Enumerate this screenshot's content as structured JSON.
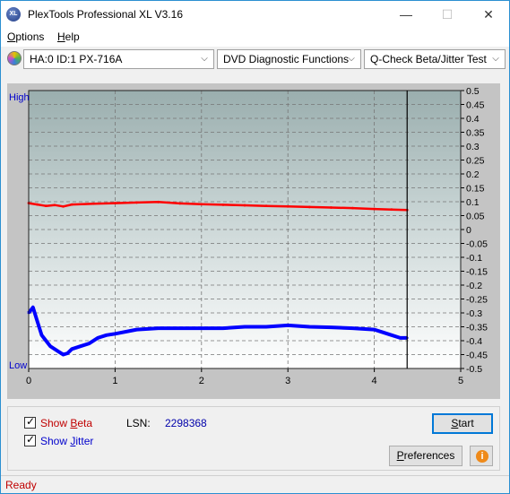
{
  "window": {
    "icon_text": "XL",
    "title": "PlexTools Professional XL V3.16",
    "minimize_glyph": "—",
    "maximize_glyph": "☐",
    "close_glyph": "✕"
  },
  "menu": {
    "items": [
      {
        "mnemonic": "O",
        "rest": "ptions"
      },
      {
        "mnemonic": "H",
        "rest": "elp"
      }
    ]
  },
  "toolbar": {
    "drive": "HA:0 ID:1  PX-716A",
    "function": "DVD Diagnostic Functions",
    "test": "Q-Check Beta/Jitter Test",
    "dropdown_glyph": "⌵"
  },
  "chart_data": {
    "type": "line",
    "left_axis": {
      "high_label": "High",
      "low_label": "Low"
    },
    "x_ticks": [
      "0",
      "1",
      "2",
      "3",
      "4",
      "5"
    ],
    "xlim": [
      0,
      5
    ],
    "y_ticks": [
      "0.5",
      "0.45",
      "0.4",
      "0.35",
      "0.3",
      "0.25",
      "0.2",
      "0.15",
      "0.1",
      "0.05",
      "0",
      "-0.05",
      "-0.1",
      "-0.15",
      "-0.2",
      "-0.25",
      "-0.3",
      "-0.35",
      "-0.4",
      "-0.45",
      "-0.5"
    ],
    "ylim": [
      -0.5,
      0.5
    ],
    "end_marker_x": 4.38,
    "grid": true,
    "series": [
      {
        "color": "#ff0000",
        "x": [
          0.0,
          0.1,
          0.2,
          0.3,
          0.4,
          0.5,
          0.75,
          1.0,
          1.25,
          1.5,
          1.75,
          2.0,
          2.25,
          2.5,
          2.75,
          3.0,
          3.25,
          3.5,
          3.75,
          4.0,
          4.2,
          4.38
        ],
        "y": [
          0.095,
          0.09,
          0.085,
          0.088,
          0.083,
          0.09,
          0.093,
          0.095,
          0.097,
          0.099,
          0.094,
          0.091,
          0.089,
          0.087,
          0.085,
          0.083,
          0.081,
          0.079,
          0.077,
          0.074,
          0.072,
          0.07
        ]
      },
      {
        "color": "#0000ff",
        "x": [
          0.0,
          0.05,
          0.1,
          0.15,
          0.2,
          0.25,
          0.3,
          0.35,
          0.4,
          0.45,
          0.5,
          0.6,
          0.7,
          0.8,
          0.9,
          1.0,
          1.25,
          1.5,
          1.75,
          2.0,
          2.25,
          2.5,
          2.75,
          3.0,
          3.25,
          3.5,
          3.75,
          4.0,
          4.1,
          4.2,
          4.3,
          4.38
        ],
        "y": [
          -0.3,
          -0.28,
          -0.33,
          -0.38,
          -0.4,
          -0.42,
          -0.43,
          -0.44,
          -0.45,
          -0.445,
          -0.43,
          -0.42,
          -0.41,
          -0.39,
          -0.38,
          -0.375,
          -0.36,
          -0.355,
          -0.355,
          -0.355,
          -0.355,
          -0.35,
          -0.35,
          -0.345,
          -0.35,
          -0.352,
          -0.355,
          -0.36,
          -0.37,
          -0.38,
          -0.39,
          -0.39
        ]
      }
    ]
  },
  "options": {
    "show_beta": {
      "before": "Show ",
      "mnemonic": "B",
      "after": "eta",
      "checked": true,
      "color": "#c00000"
    },
    "show_jitter": {
      "before": "Show ",
      "mnemonic": "J",
      "after": "itter",
      "checked": true,
      "color": "#0000cc"
    },
    "checkmark": "✓"
  },
  "lsn": {
    "label": "LSN:",
    "value": "2298368"
  },
  "buttons": {
    "start": {
      "mnemonic": "S",
      "rest": "tart"
    },
    "preferences": {
      "mnemonic": "P",
      "rest": "references"
    },
    "info_glyph": "i"
  },
  "status": {
    "text": "Ready"
  }
}
